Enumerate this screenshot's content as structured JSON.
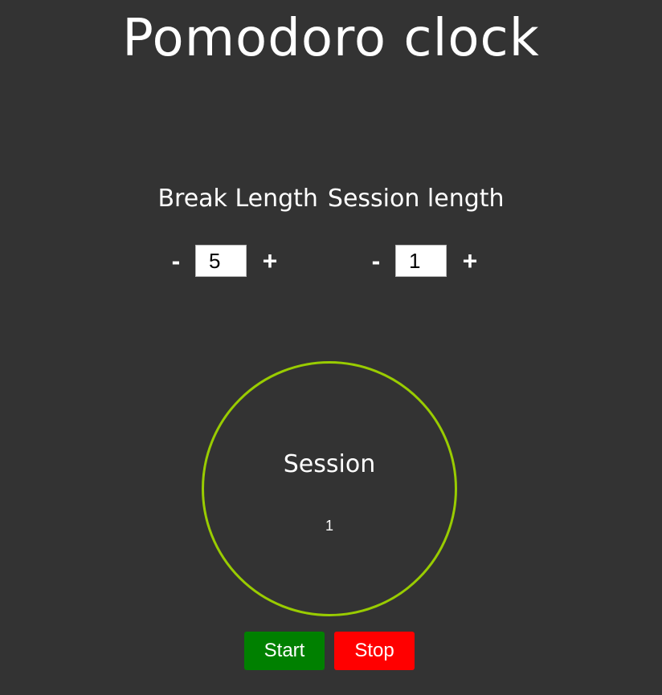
{
  "header": {
    "title": "Pomodoro clock"
  },
  "settings": {
    "break_label": "Break Length",
    "session_label": "Session length",
    "break": {
      "minus_label": "-",
      "value": "5",
      "plus_label": "+"
    },
    "session": {
      "minus_label": "-",
      "value": "1",
      "plus_label": "+"
    }
  },
  "timer": {
    "mode_label": "Session",
    "value": "1",
    "ring_color": "#99cc00"
  },
  "actions": {
    "start_label": "Start",
    "start_color": "#008000",
    "stop_label": "Stop",
    "stop_color": "#ff0000"
  }
}
